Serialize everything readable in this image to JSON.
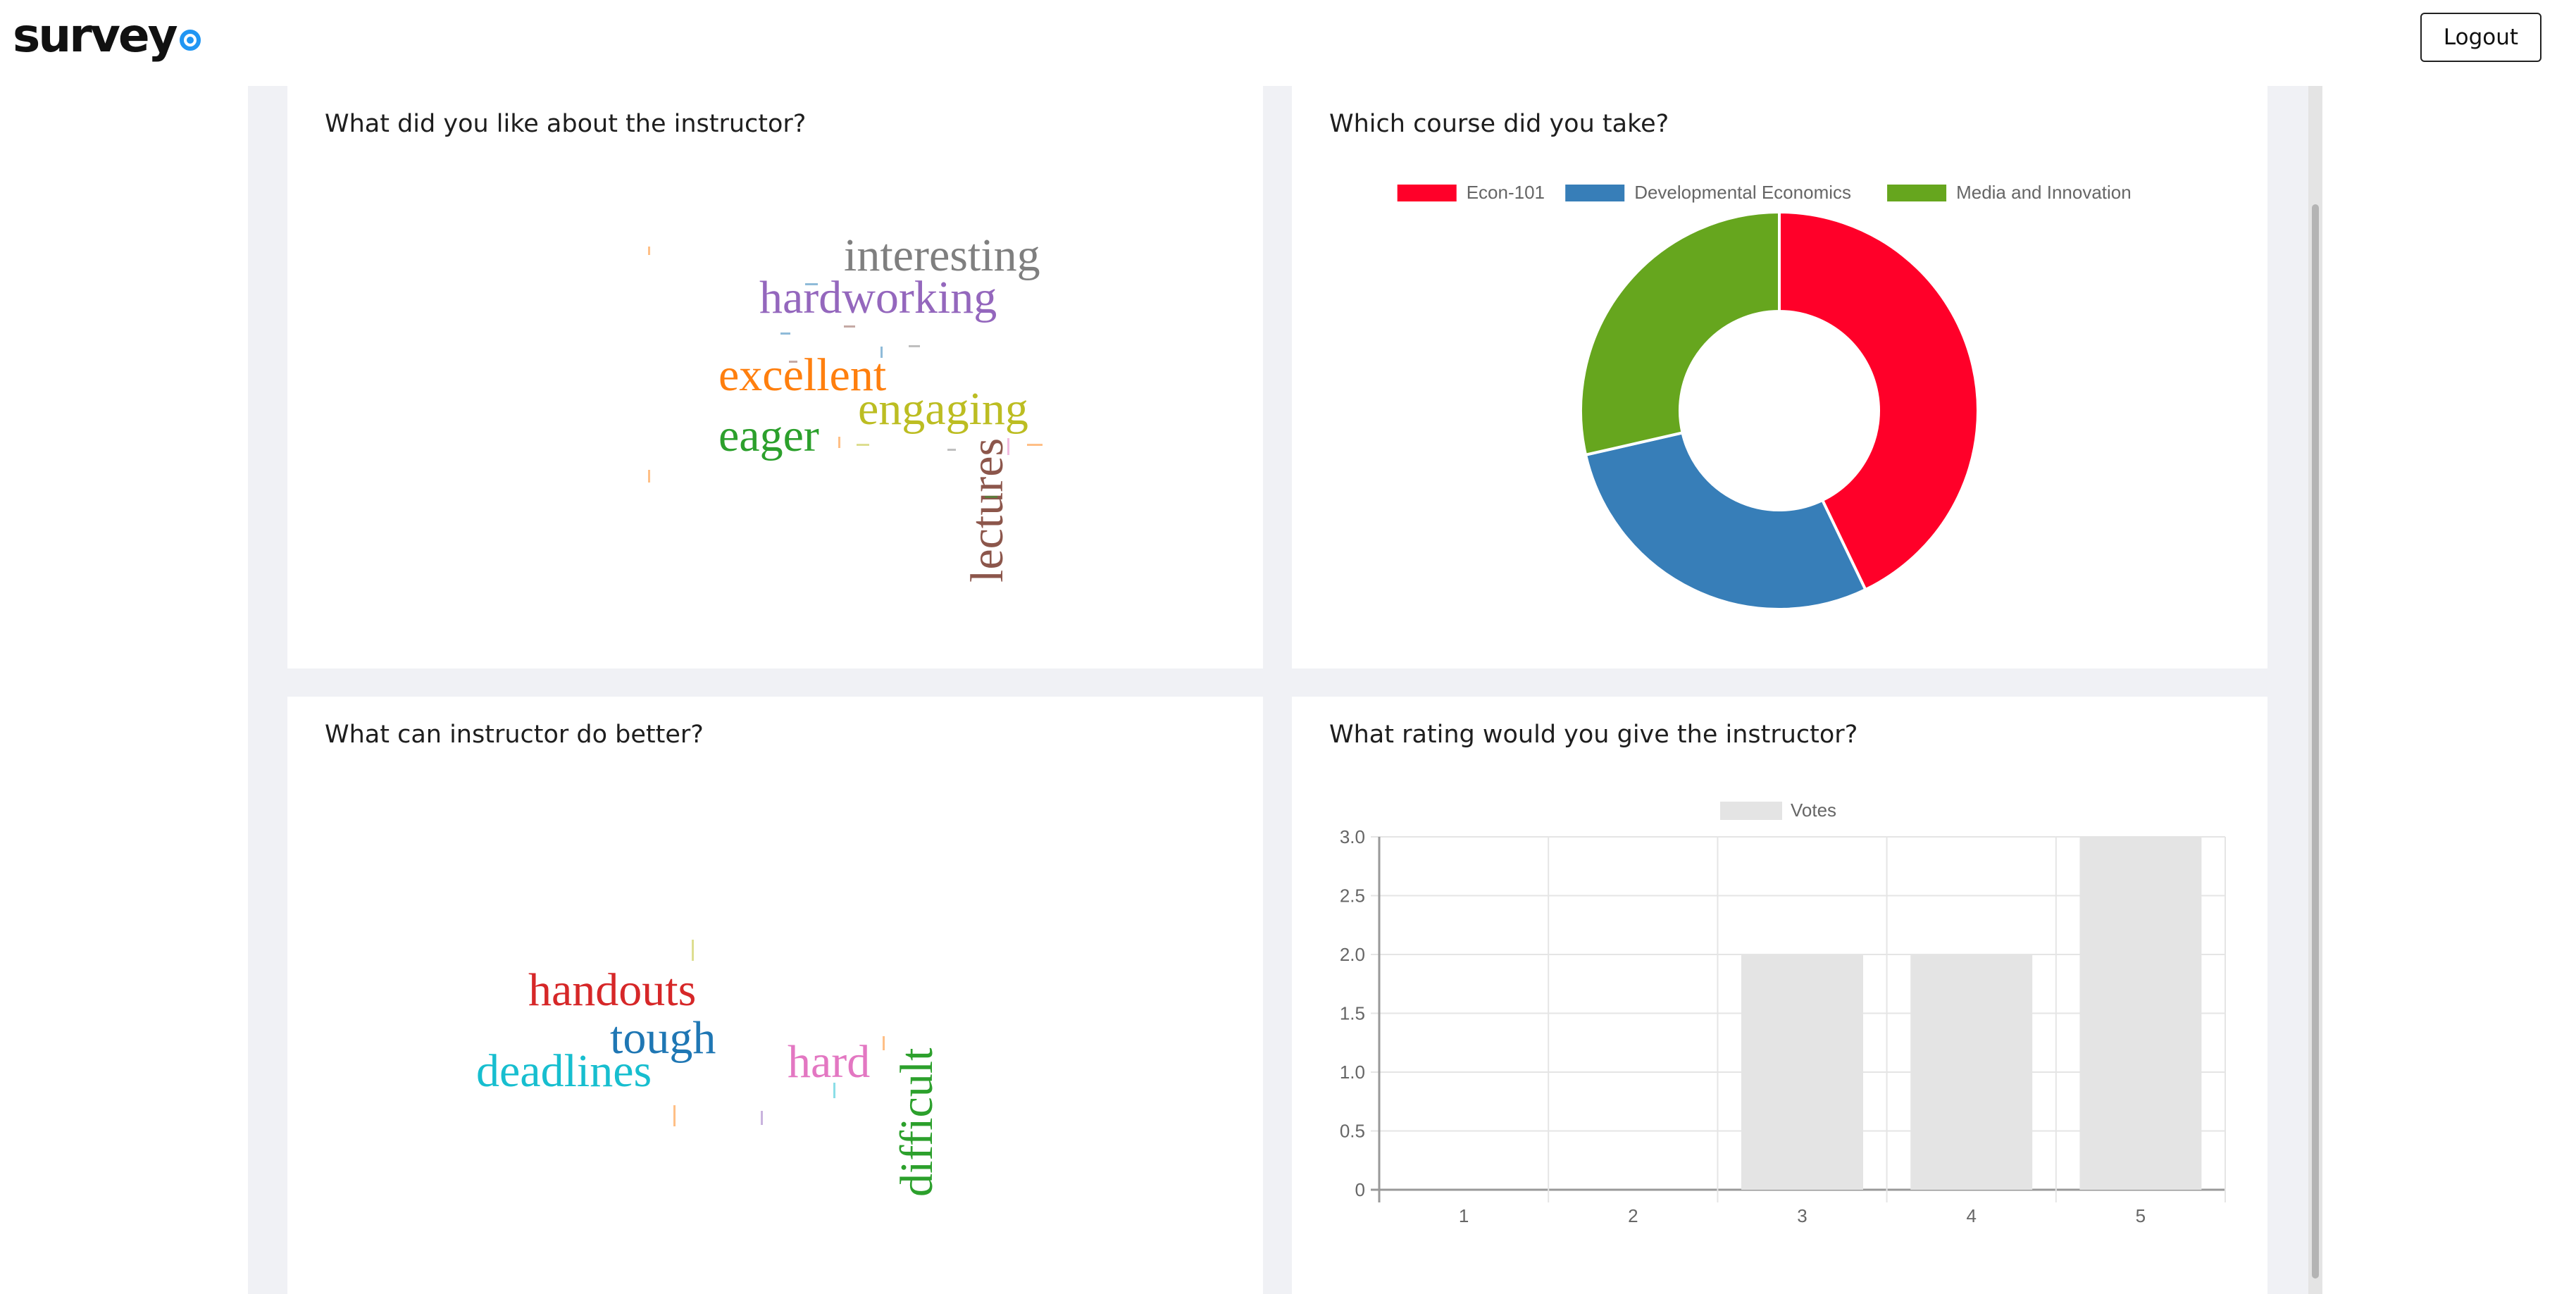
{
  "app": {
    "logo_text": "survey",
    "logout_label": "Logout"
  },
  "cards": {
    "liked": {
      "title": "What did you like about the instructor?",
      "words": [
        {
          "text": "interesting",
          "color": "#7f7f7f"
        },
        {
          "text": "hardworking",
          "color": "#9467bd"
        },
        {
          "text": "excellent",
          "color": "#ff7f0e"
        },
        {
          "text": "engaging",
          "color": "#bcbd22"
        },
        {
          "text": "eager",
          "color": "#2ca02c"
        },
        {
          "text": "lectures",
          "color": "#8c564b"
        }
      ]
    },
    "course": {
      "title": "Which course did you take?"
    },
    "improve": {
      "title": "What can instructor do better?",
      "words": [
        {
          "text": "handouts",
          "color": "#d62728"
        },
        {
          "text": "tough",
          "color": "#1f77b4"
        },
        {
          "text": "deadlines",
          "color": "#17becf"
        },
        {
          "text": "hard",
          "color": "#e377c2"
        },
        {
          "text": "difficult",
          "color": "#2ca02c"
        }
      ]
    },
    "rating": {
      "title": "What rating would you give the instructor?"
    }
  },
  "chart_data": [
    {
      "type": "pie",
      "variant": "doughnut",
      "categories": [
        "Econ-101",
        "Developmental Economics",
        "Media and Innovation"
      ],
      "values": [
        3,
        2,
        2
      ],
      "colors": [
        "#ff0029",
        "#377eb8",
        "#66a61e"
      ],
      "legend": "top"
    },
    {
      "type": "bar",
      "categories": [
        "1",
        "2",
        "3",
        "4",
        "5"
      ],
      "series": [
        {
          "name": "Votes",
          "values": [
            0,
            0,
            2,
            2,
            3
          ]
        }
      ],
      "yticks": [
        "0",
        "0.5",
        "1.0",
        "1.5",
        "2.0",
        "2.5",
        "3.0"
      ],
      "ylim": [
        0,
        3
      ],
      "grid": true,
      "legend": "top",
      "bar_color": "#e4e4e4"
    }
  ]
}
